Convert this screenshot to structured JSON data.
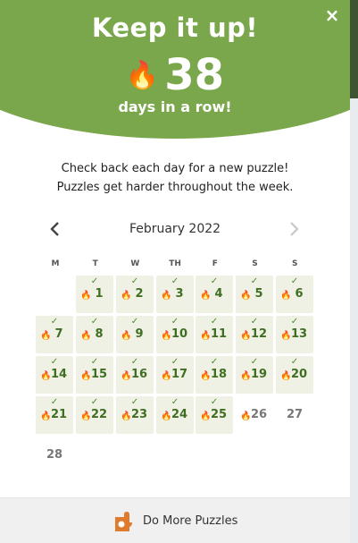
{
  "header": {
    "close_glyph": "×",
    "title": "Keep it up!",
    "streak_icon": "flame-icon",
    "streak_count": "38",
    "streak_caption": "days in a row!",
    "color": "#7aa74b"
  },
  "message": {
    "line1": "Check back each day for a new puzzle!",
    "line2": "Puzzles get harder throughout the week."
  },
  "calendar": {
    "month": "February 2022",
    "prev_glyph": "‹",
    "next_glyph": "›",
    "weekdays": [
      "M",
      "T",
      "W",
      "TH",
      "F",
      "S",
      "S"
    ],
    "days": [
      {
        "d": "1",
        "state": "done"
      },
      {
        "d": "2",
        "state": "done"
      },
      {
        "d": "3",
        "state": "done"
      },
      {
        "d": "4",
        "state": "done"
      },
      {
        "d": "5",
        "state": "done"
      },
      {
        "d": "6",
        "state": "done"
      },
      {
        "d": "7",
        "state": "done"
      },
      {
        "d": "8",
        "state": "done"
      },
      {
        "d": "9",
        "state": "done"
      },
      {
        "d": "10",
        "state": "done"
      },
      {
        "d": "11",
        "state": "done"
      },
      {
        "d": "12",
        "state": "done"
      },
      {
        "d": "13",
        "state": "done"
      },
      {
        "d": "14",
        "state": "done"
      },
      {
        "d": "15",
        "state": "done"
      },
      {
        "d": "16",
        "state": "done"
      },
      {
        "d": "17",
        "state": "done"
      },
      {
        "d": "18",
        "state": "done"
      },
      {
        "d": "19",
        "state": "done"
      },
      {
        "d": "20",
        "state": "done"
      },
      {
        "d": "21",
        "state": "done"
      },
      {
        "d": "22",
        "state": "done"
      },
      {
        "d": "23",
        "state": "done"
      },
      {
        "d": "24",
        "state": "done"
      },
      {
        "d": "25",
        "state": "done"
      },
      {
        "d": "26",
        "state": "streak"
      },
      {
        "d": "27",
        "state": "none"
      },
      {
        "d": "28",
        "state": "none"
      }
    ],
    "check_glyph": "✓",
    "flame_glyph": "🔥"
  },
  "footer": {
    "button_label": "Do More Puzzles",
    "logo_icon": "puzzle-logo-icon"
  }
}
